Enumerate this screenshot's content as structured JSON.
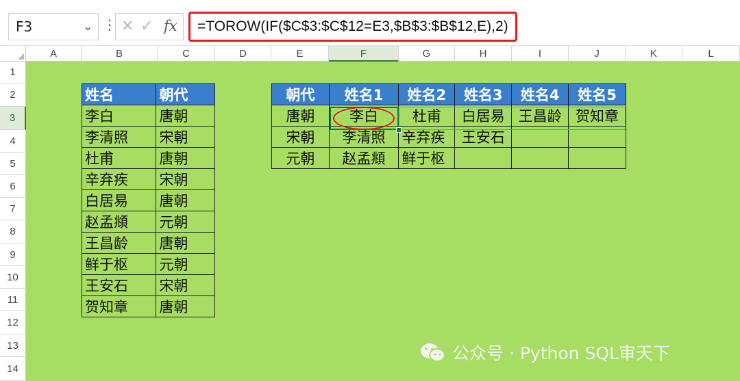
{
  "name_box": {
    "value": "F3"
  },
  "formula_bar": {
    "cancel_icon": "✕",
    "enter_icon": "✓",
    "fx_label": "fx",
    "formula": "=TOROW(IF($C$3:$C$12=E3,$B$3:$B$12,E),2)"
  },
  "columns": [
    "A",
    "B",
    "C",
    "D",
    "E",
    "F",
    "G",
    "H",
    "I",
    "J",
    "K",
    "L"
  ],
  "rows": [
    "1",
    "2",
    "3",
    "4",
    "5",
    "6",
    "7",
    "8",
    "9",
    "10",
    "11",
    "12",
    "13",
    "14"
  ],
  "active_cell": {
    "column": "F",
    "row": "3"
  },
  "left_table": {
    "headers": [
      "姓名",
      "朝代"
    ],
    "rows": [
      [
        "李白",
        "唐朝"
      ],
      [
        "李清照",
        "宋朝"
      ],
      [
        "杜甫",
        "唐朝"
      ],
      [
        "辛弃疾",
        "宋朝"
      ],
      [
        "白居易",
        "唐朝"
      ],
      [
        "赵孟頫",
        "元朝"
      ],
      [
        "王昌龄",
        "唐朝"
      ],
      [
        "鲜于枢",
        "元朝"
      ],
      [
        "王安石",
        "宋朝"
      ],
      [
        "贺知章",
        "唐朝"
      ]
    ]
  },
  "right_table": {
    "headers": [
      "朝代",
      "姓名1",
      "姓名2",
      "姓名3",
      "姓名4",
      "姓名5"
    ],
    "rows": [
      [
        "唐朝",
        "李白",
        "杜甫",
        "白居易",
        "王昌龄",
        "贺知章"
      ],
      [
        "宋朝",
        "李清照",
        "辛弃疾",
        "王安石",
        "",
        ""
      ],
      [
        "元朝",
        "赵孟頫",
        "鲜于枢",
        "",
        "",
        ""
      ]
    ]
  },
  "watermark": {
    "text": "公众号 · Python SQL审天下"
  },
  "colors": {
    "sheet_bg": "#a6dd62",
    "header_bg": "#3a7fcb",
    "highlight": "#e31a1a"
  }
}
